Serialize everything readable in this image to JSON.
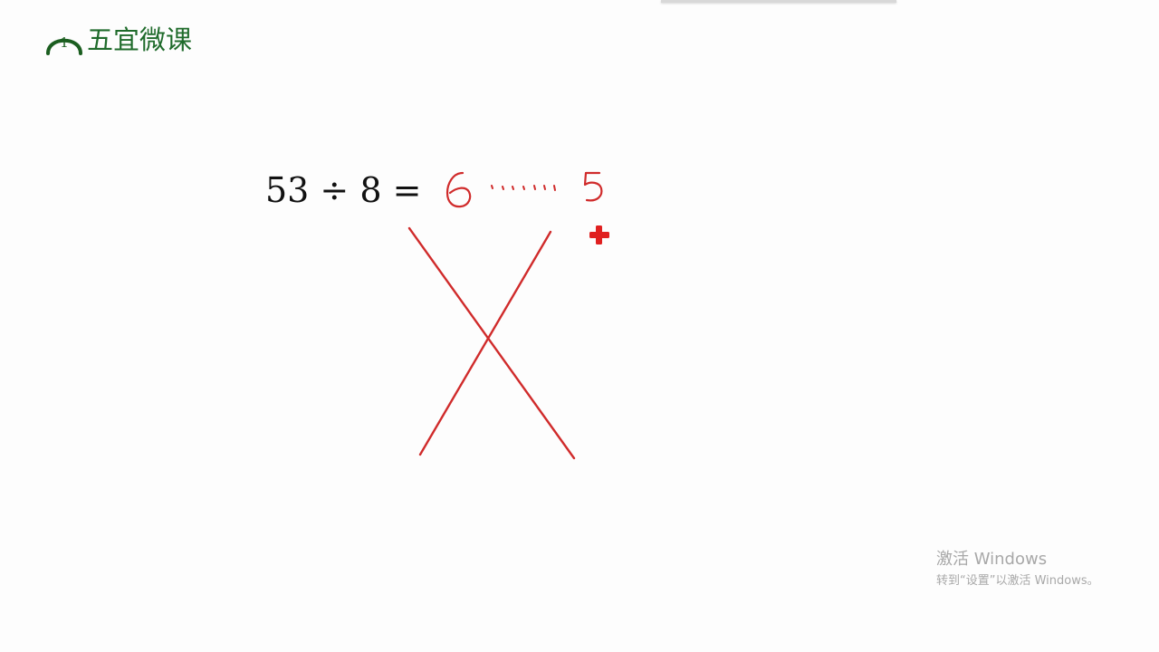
{
  "header": {
    "logo_number": "1",
    "logo_text": "五宜微课"
  },
  "board": {
    "equation": "53 ÷ 8 =",
    "handwritten_quotient": "6",
    "handwritten_dots": "……",
    "handwritten_remainder": "5",
    "ink_color": "#d02b2b",
    "cross_mark": "X"
  },
  "cursor": {
    "icon": "red-cross-cursor-icon",
    "color": "#e02020"
  },
  "watermark": {
    "title": "激活 Windows",
    "subtitle": "转到“设置”以激活 Windows。"
  },
  "colors": {
    "logo_green": "#1f6b2b",
    "background": "#fdfdfd",
    "watermark_gray": "#a8a8a8"
  }
}
